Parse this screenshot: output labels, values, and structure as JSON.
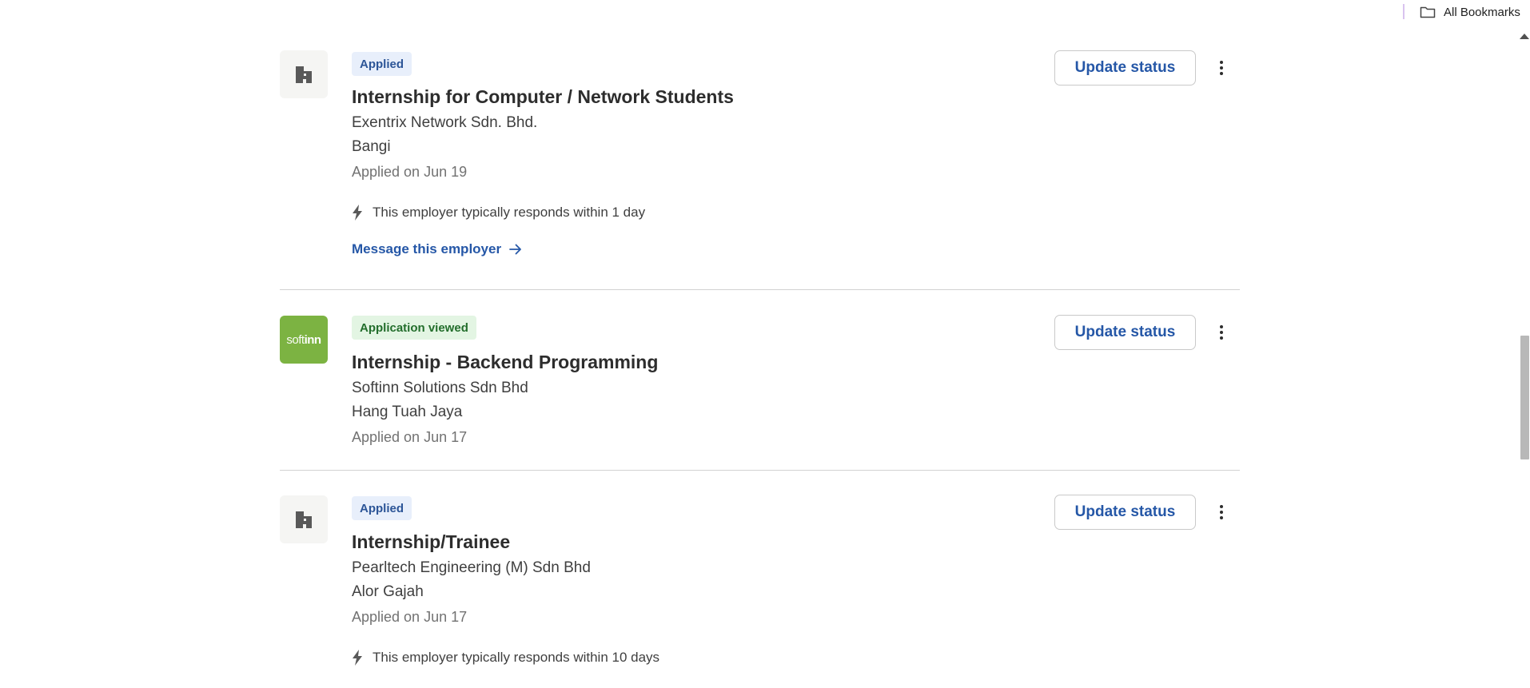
{
  "bookmarks_bar": {
    "all_bookmarks_label": "All Bookmarks",
    "folder_icon": "folder-icon"
  },
  "jobs": [
    {
      "status": "Applied",
      "title": "Internship for Computer / Network Students",
      "company": "Exentrix Network Sdn. Bhd.",
      "location": "Bangi",
      "applied_date": "Applied on Jun 19",
      "response_note": "This employer typically responds within 1 day",
      "message_link": "Message this employer",
      "update_button": "Update status",
      "logo_icon": "building-icon"
    },
    {
      "status": "Application viewed",
      "title": "Internship - Backend Programming",
      "company": "Softinn Solutions Sdn Bhd",
      "location": "Hang Tuah Jaya",
      "applied_date": "Applied on Jun 17",
      "update_button": "Update status",
      "logo_text_soft": "soft",
      "logo_text_inn": "inn",
      "logo_color": "#7cb342"
    },
    {
      "status": "Applied",
      "title": "Internship/Trainee",
      "company": "Pearltech Engineering (M) Sdn Bhd",
      "location": "Alor Gajah",
      "applied_date": "Applied on Jun 17",
      "response_note": "This employer typically responds within 10 days",
      "update_button": "Update status",
      "logo_icon": "building-icon"
    }
  ],
  "colors": {
    "link_blue": "#2557a7",
    "applied_badge_bg": "#e8effb",
    "viewed_badge_bg": "#e3f5e3"
  }
}
